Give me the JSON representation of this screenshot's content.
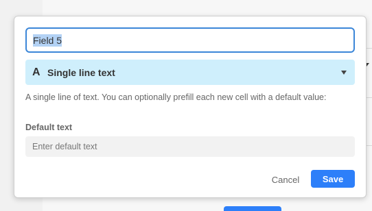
{
  "field_name": {
    "value": "Field 5"
  },
  "field_type": {
    "icon": "A",
    "label": "Single line text"
  },
  "description": "A single line of text. You can optionally prefill each new cell with a default value:",
  "default_text": {
    "label": "Default text",
    "placeholder": "Enter default text",
    "value": ""
  },
  "actions": {
    "cancel_label": "Cancel",
    "save_label": "Save"
  },
  "colors": {
    "accent": "#2d7ff9",
    "type_select_bg": "#cfeffc",
    "focus_border": "#3b86d8"
  }
}
